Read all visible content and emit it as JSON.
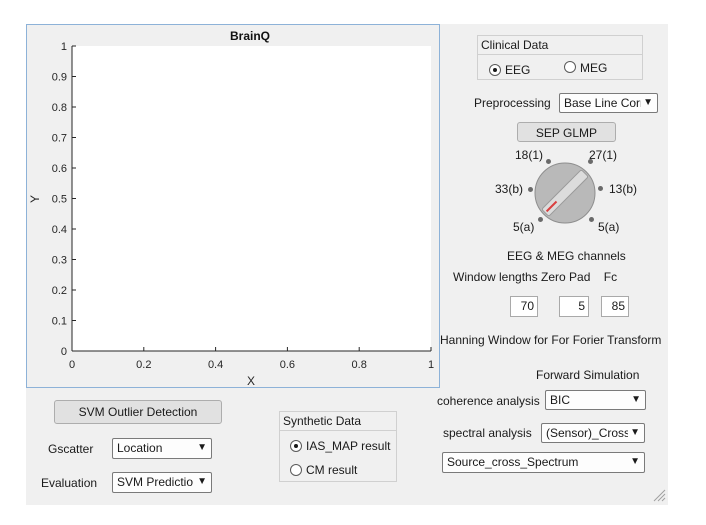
{
  "axes": {
    "title": "BrainQ",
    "xlabel": "X",
    "ylabel": "Y",
    "x_ticks": [
      "0",
      "0.2",
      "0.4",
      "0.6",
      "0.8",
      "1"
    ],
    "y_ticks": [
      "0",
      "0.1",
      "0.2",
      "0.3",
      "0.4",
      "0.5",
      "0.6",
      "0.7",
      "0.8",
      "0.9",
      "1"
    ]
  },
  "clinical_data": {
    "title": "Clinical Data",
    "options": [
      "EEG",
      "MEG"
    ],
    "selected": "EEG"
  },
  "preprocessing": {
    "label": "Preprocessing",
    "value": "Base Line Corr"
  },
  "sep_glmp_button": "SEP GLMP",
  "knob": {
    "labels": {
      "top_left": "18(1)",
      "top_right": "27(1)",
      "left": "33(b)",
      "right": "13(b)",
      "bottom_left": "5(a)",
      "bottom_right": "5(a)"
    }
  },
  "channels_label": "EEG & MEG channels",
  "window_header": "Window lengths Zero Pad    Fc",
  "fields": {
    "window_length": "70",
    "zero_pad": "5",
    "fc": "85"
  },
  "hanning_label": "Hanning Window for For Forier Transform",
  "forward_sim_label": "Forward Simulation",
  "coherence": {
    "label": "coherence analysis",
    "value": "BIC"
  },
  "spectral": {
    "label": "spectral analysis",
    "value": "(Sensor)_Cross"
  },
  "spectrum_select": "Source_cross_Spectrum",
  "svm_button": "SVM Outlier Detection",
  "gscatter": {
    "label": "Gscatter",
    "value": "Location"
  },
  "evaluation": {
    "label": "Evaluation",
    "value": "SVM  Predictio"
  },
  "synthetic_data": {
    "title": "Synthetic Data",
    "options": [
      "IAS_MAP result",
      "CM result"
    ],
    "selected": "IAS_MAP result"
  }
}
